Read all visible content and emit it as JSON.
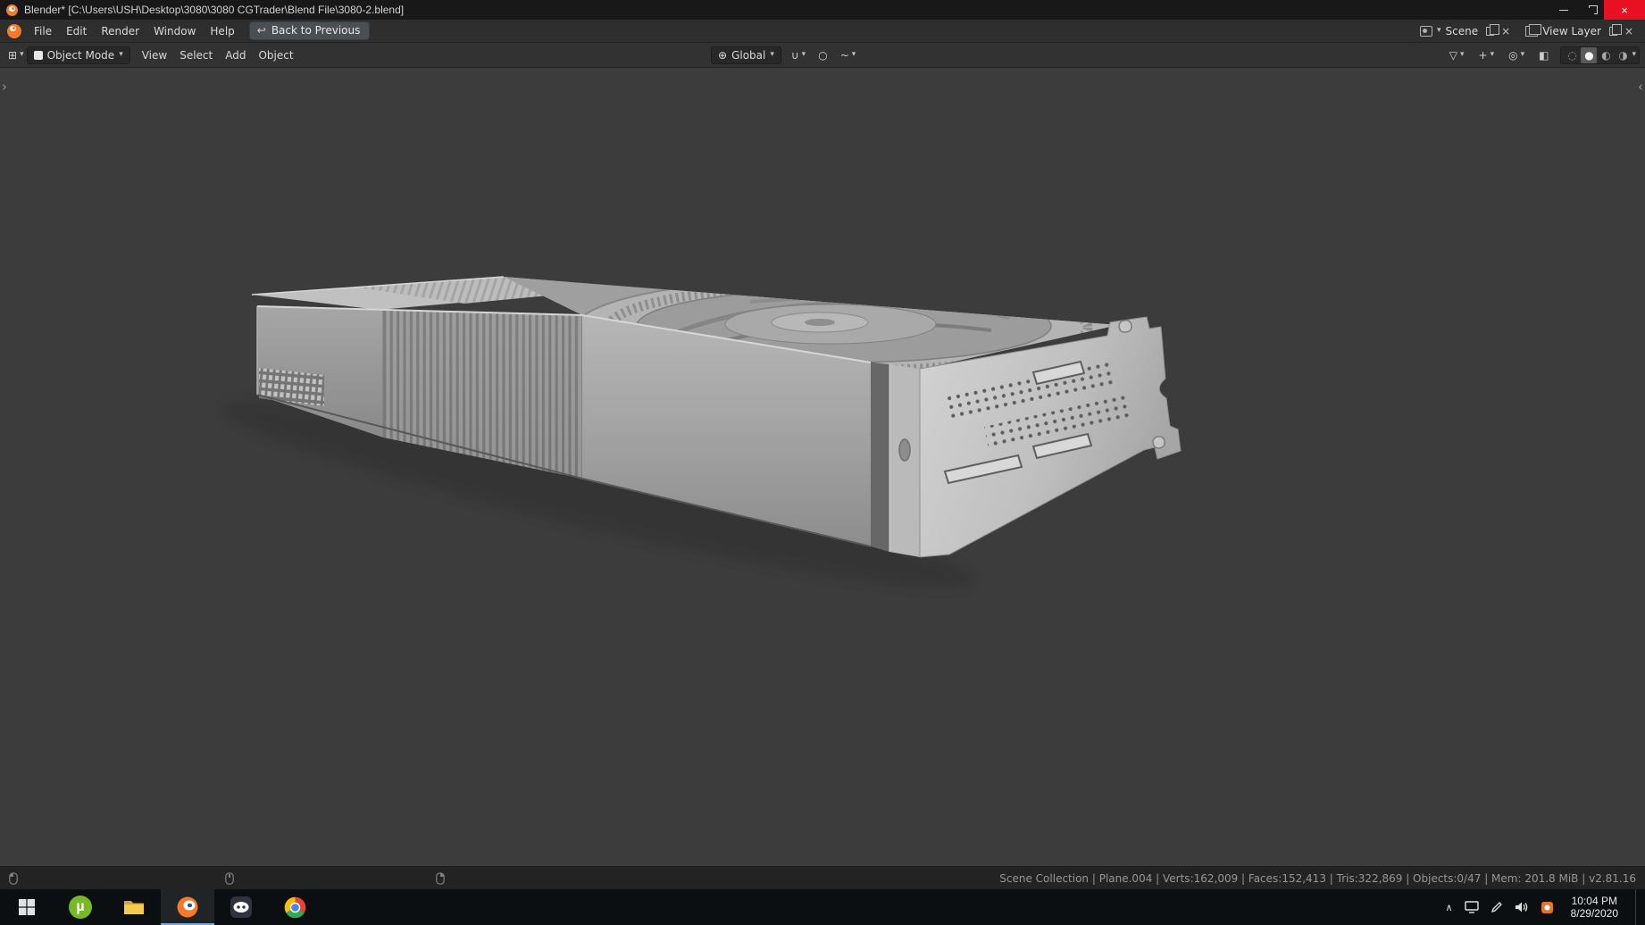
{
  "titlebar": {
    "title": "Blender* [C:\\Users\\USH\\Desktop\\3080\\3080 CGTrader\\Blend File\\3080-2.blend]"
  },
  "topbar": {
    "menus": [
      "File",
      "Edit",
      "Render",
      "Window",
      "Help"
    ],
    "back_button": "Back to Previous",
    "scene_label": "Scene",
    "view_layer_label": "View Layer"
  },
  "viewport_header": {
    "mode": "Object Mode",
    "menus": [
      "View",
      "Select",
      "Add",
      "Object"
    ],
    "orientation": "Global"
  },
  "statusbar": {
    "info": "Scene Collection | Plane.004 | Verts:162,009 | Faces:152,413 | Tris:322,869 | Objects:0/47 | Mem: 201.8 MiB | v2.81.16"
  },
  "taskbar": {
    "time": "10:04 PM",
    "date": "8/29/2020",
    "utorrent_glyph": "µ"
  },
  "icons": {
    "caret": "▾",
    "close_x": "×",
    "back_arrow": "↩",
    "editor_grid": "⊞",
    "globe": "⊕",
    "magnet": "∪",
    "prop_circle": "○",
    "falloff_wave": "~",
    "funnel": "▽",
    "gizmo": "+",
    "overlays": "◎",
    "xray": "◧",
    "sphere_wire": "◌",
    "sphere_solid": "●",
    "sphere_material": "◐",
    "sphere_render": "◑",
    "chevron_up": "∧",
    "panel_arrow_left": "‹",
    "panel_arrow_right": "›"
  },
  "colors": {
    "viewport_bg": "#3c3c3c",
    "header_bg": "#323232",
    "topbar_bg": "#2e2e2e",
    "statusbar_bg": "#232323",
    "taskbar_bg": "#0c0f12",
    "close_red": "#e81123",
    "blender_orange": "#f5792a",
    "active_taskbar_underline": "#76a9d8"
  }
}
